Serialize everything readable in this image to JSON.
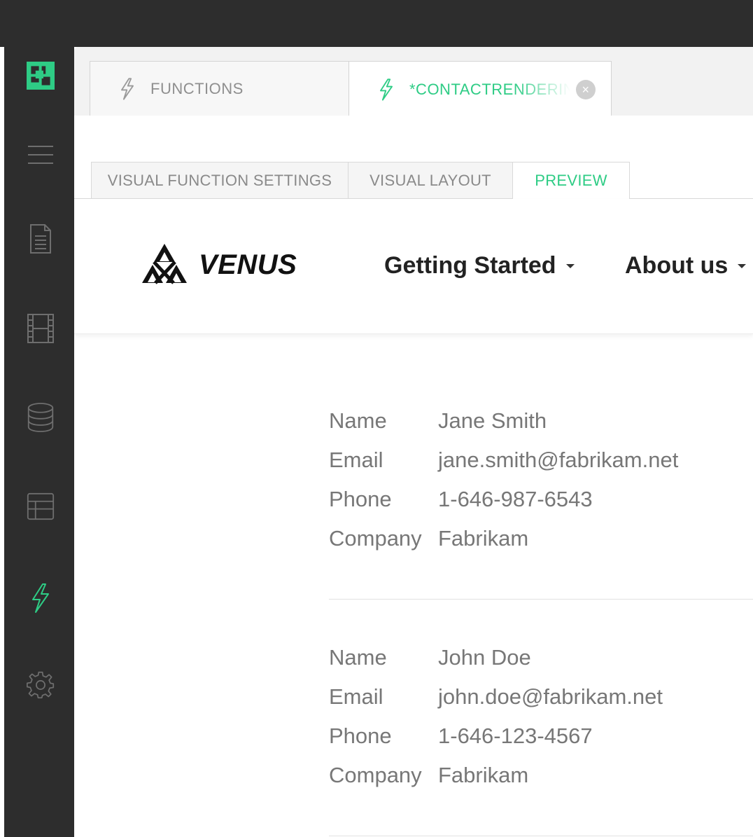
{
  "colors": {
    "sidebar_bg": "#2d2d2d",
    "accent": "#2ecc85",
    "tab_inactive_text": "#8f8f8f"
  },
  "sidebar": {
    "icons": [
      "app-logo-icon",
      "menu-icon",
      "document-icon",
      "film-icon",
      "database-icon",
      "layout-icon",
      "lightning-icon",
      "settings-icon"
    ],
    "active": "lightning-icon"
  },
  "top_tabs": [
    {
      "label": "FUNCTIONS",
      "active": false
    },
    {
      "label": "*CONTACTRENDERIN",
      "active": true
    }
  ],
  "sub_tabs": [
    {
      "label": "VISUAL FUNCTION SETTINGS",
      "active": false
    },
    {
      "label": "VISUAL LAYOUT",
      "active": false
    },
    {
      "label": "PREVIEW",
      "active": true
    }
  ],
  "site": {
    "brand": "VENUS",
    "nav": [
      "Getting Started",
      "About us"
    ]
  },
  "contacts": [
    {
      "name_label": "Name",
      "name": "Jane Smith",
      "email_label": "Email",
      "email": "jane.smith@fabrikam.net",
      "phone_label": "Phone",
      "phone": "1-646-987-6543",
      "company_label": "Company",
      "company": "Fabrikam"
    },
    {
      "name_label": "Name",
      "name": "John Doe",
      "email_label": "Email",
      "email": "john.doe@fabrikam.net",
      "phone_label": "Phone",
      "phone": "1-646-123-4567",
      "company_label": "Company",
      "company": "Fabrikam"
    }
  ]
}
